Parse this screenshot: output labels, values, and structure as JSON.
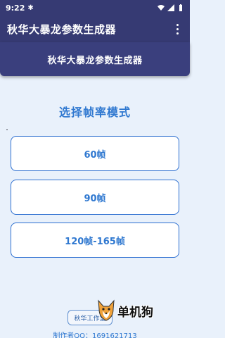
{
  "status_bar": {
    "time": "9:22",
    "bug_icon": "bug-icon",
    "icons": [
      "wifi-icon",
      "signal-icon",
      "battery-icon"
    ]
  },
  "app_bar": {
    "title": "秋华大暴龙参数生成器",
    "menu_icon": "overflow-menu-icon"
  },
  "header": {
    "title": "秋华大暴龙参数生成器"
  },
  "main": {
    "section_title": "选择帧率模式",
    "options": [
      {
        "label": "60帧"
      },
      {
        "label": "90帧"
      },
      {
        "label": "120帧-165帧"
      }
    ]
  },
  "footer": {
    "studio_button": "秋华工作室",
    "author": "制作者QQ：1691621713"
  },
  "watermark": {
    "text": "单机狗"
  },
  "colors": {
    "appbar": "#363a73",
    "accent": "#2f78d0",
    "background": "#e9f1fb",
    "button_border": "#2d6fd0"
  }
}
